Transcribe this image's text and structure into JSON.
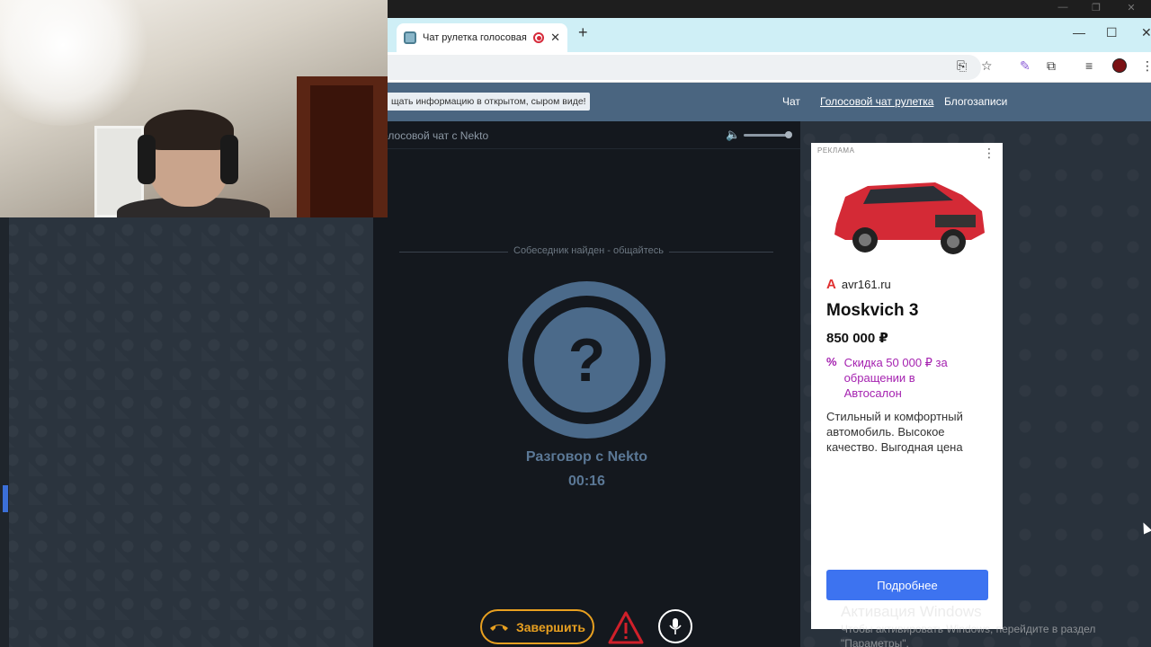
{
  "browser": {
    "tab_title": "Чат рулетка голосовая — ",
    "tab_close": "✕",
    "new_tab": "+",
    "window_minimize": "—",
    "window_maximize": "☐",
    "window_close": "✕"
  },
  "site": {
    "hint_text": "щать информацию в открытом, сыром виде!",
    "nav": [
      {
        "label": "Чат"
      },
      {
        "label": "Голосовой чат рулетка"
      },
      {
        "label": "Блогозаписи"
      }
    ]
  },
  "call": {
    "title": "олосовой чат с Nekto",
    "found_text": "Собеседник найден - общайтесь",
    "avatar_symbol": "?",
    "talk_label": "Разговор с Nekto",
    "timer": "00:16",
    "end_button": "Завершить"
  },
  "ad": {
    "label": "РЕКЛАМА",
    "menu": "⋮",
    "domain": "avr161.ru",
    "title": "Moskvich 3",
    "price": "850 000 ₽",
    "promo_symbol": "%",
    "promo_text": "Скидка 50 000 ₽ за обращении в Автосалон",
    "description": "Стильный и комфортный автомобиль. Высокое качество. Выгодная цена",
    "cta": "Подробнее"
  },
  "watermark": {
    "line1": "Активация Windows",
    "line2": "Чтобы активировать Windows, перейдите в раздел",
    "line3": "\"Параметры\"."
  },
  "colors": {
    "header": "#4a6580",
    "accent_orange": "#e8a020",
    "avatar_blue": "#4b6a8a",
    "ad_cta": "#3d73f0",
    "promo": "#a522b0"
  }
}
